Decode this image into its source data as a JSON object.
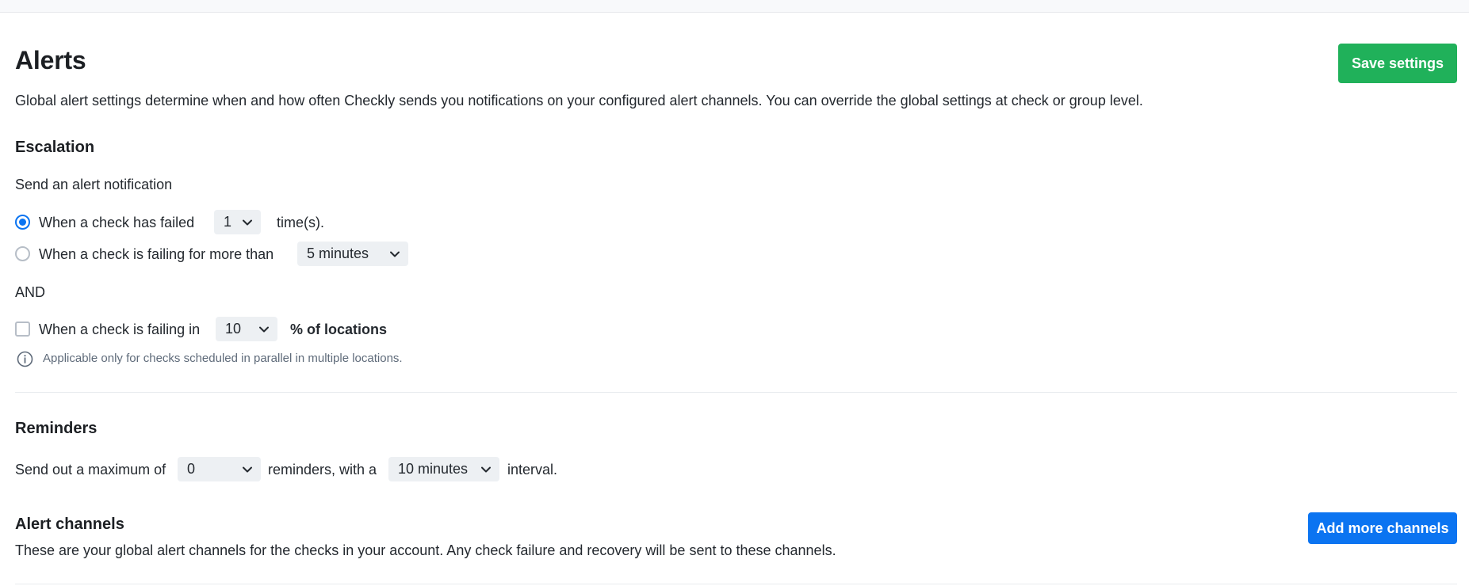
{
  "header": {
    "title": "Alerts",
    "description": "Global alert settings determine when and how often Checkly sends you notifications on your configured alert channels. You can override the global settings at check or group level.",
    "save_label": "Save settings"
  },
  "escalation": {
    "title": "Escalation",
    "intro": "Send an alert notification",
    "option_failed": {
      "label": "When a check has failed",
      "value": "1",
      "suffix": "time(s)."
    },
    "option_failing_time": {
      "label": "When a check is failing for more than",
      "value": "5 minutes"
    },
    "and_label": "AND",
    "option_locations": {
      "label": "When a check is failing in",
      "value": "10",
      "suffix": "% of locations"
    },
    "hint": "Applicable only for checks scheduled in parallel in multiple locations."
  },
  "reminders": {
    "title": "Reminders",
    "prefix": "Send out a maximum of",
    "count": "0",
    "middle": "reminders, with a",
    "interval": "10 minutes",
    "suffix": "interval."
  },
  "channels": {
    "title": "Alert channels",
    "description": "These are your global alert channels for the checks in your account. Any check failure and recovery will be sent to these channels.",
    "add_label": "Add more channels"
  },
  "colors": {
    "save_button": "#20b15a",
    "primary": "#0b74f1",
    "select_bg": "#edf0f3"
  }
}
